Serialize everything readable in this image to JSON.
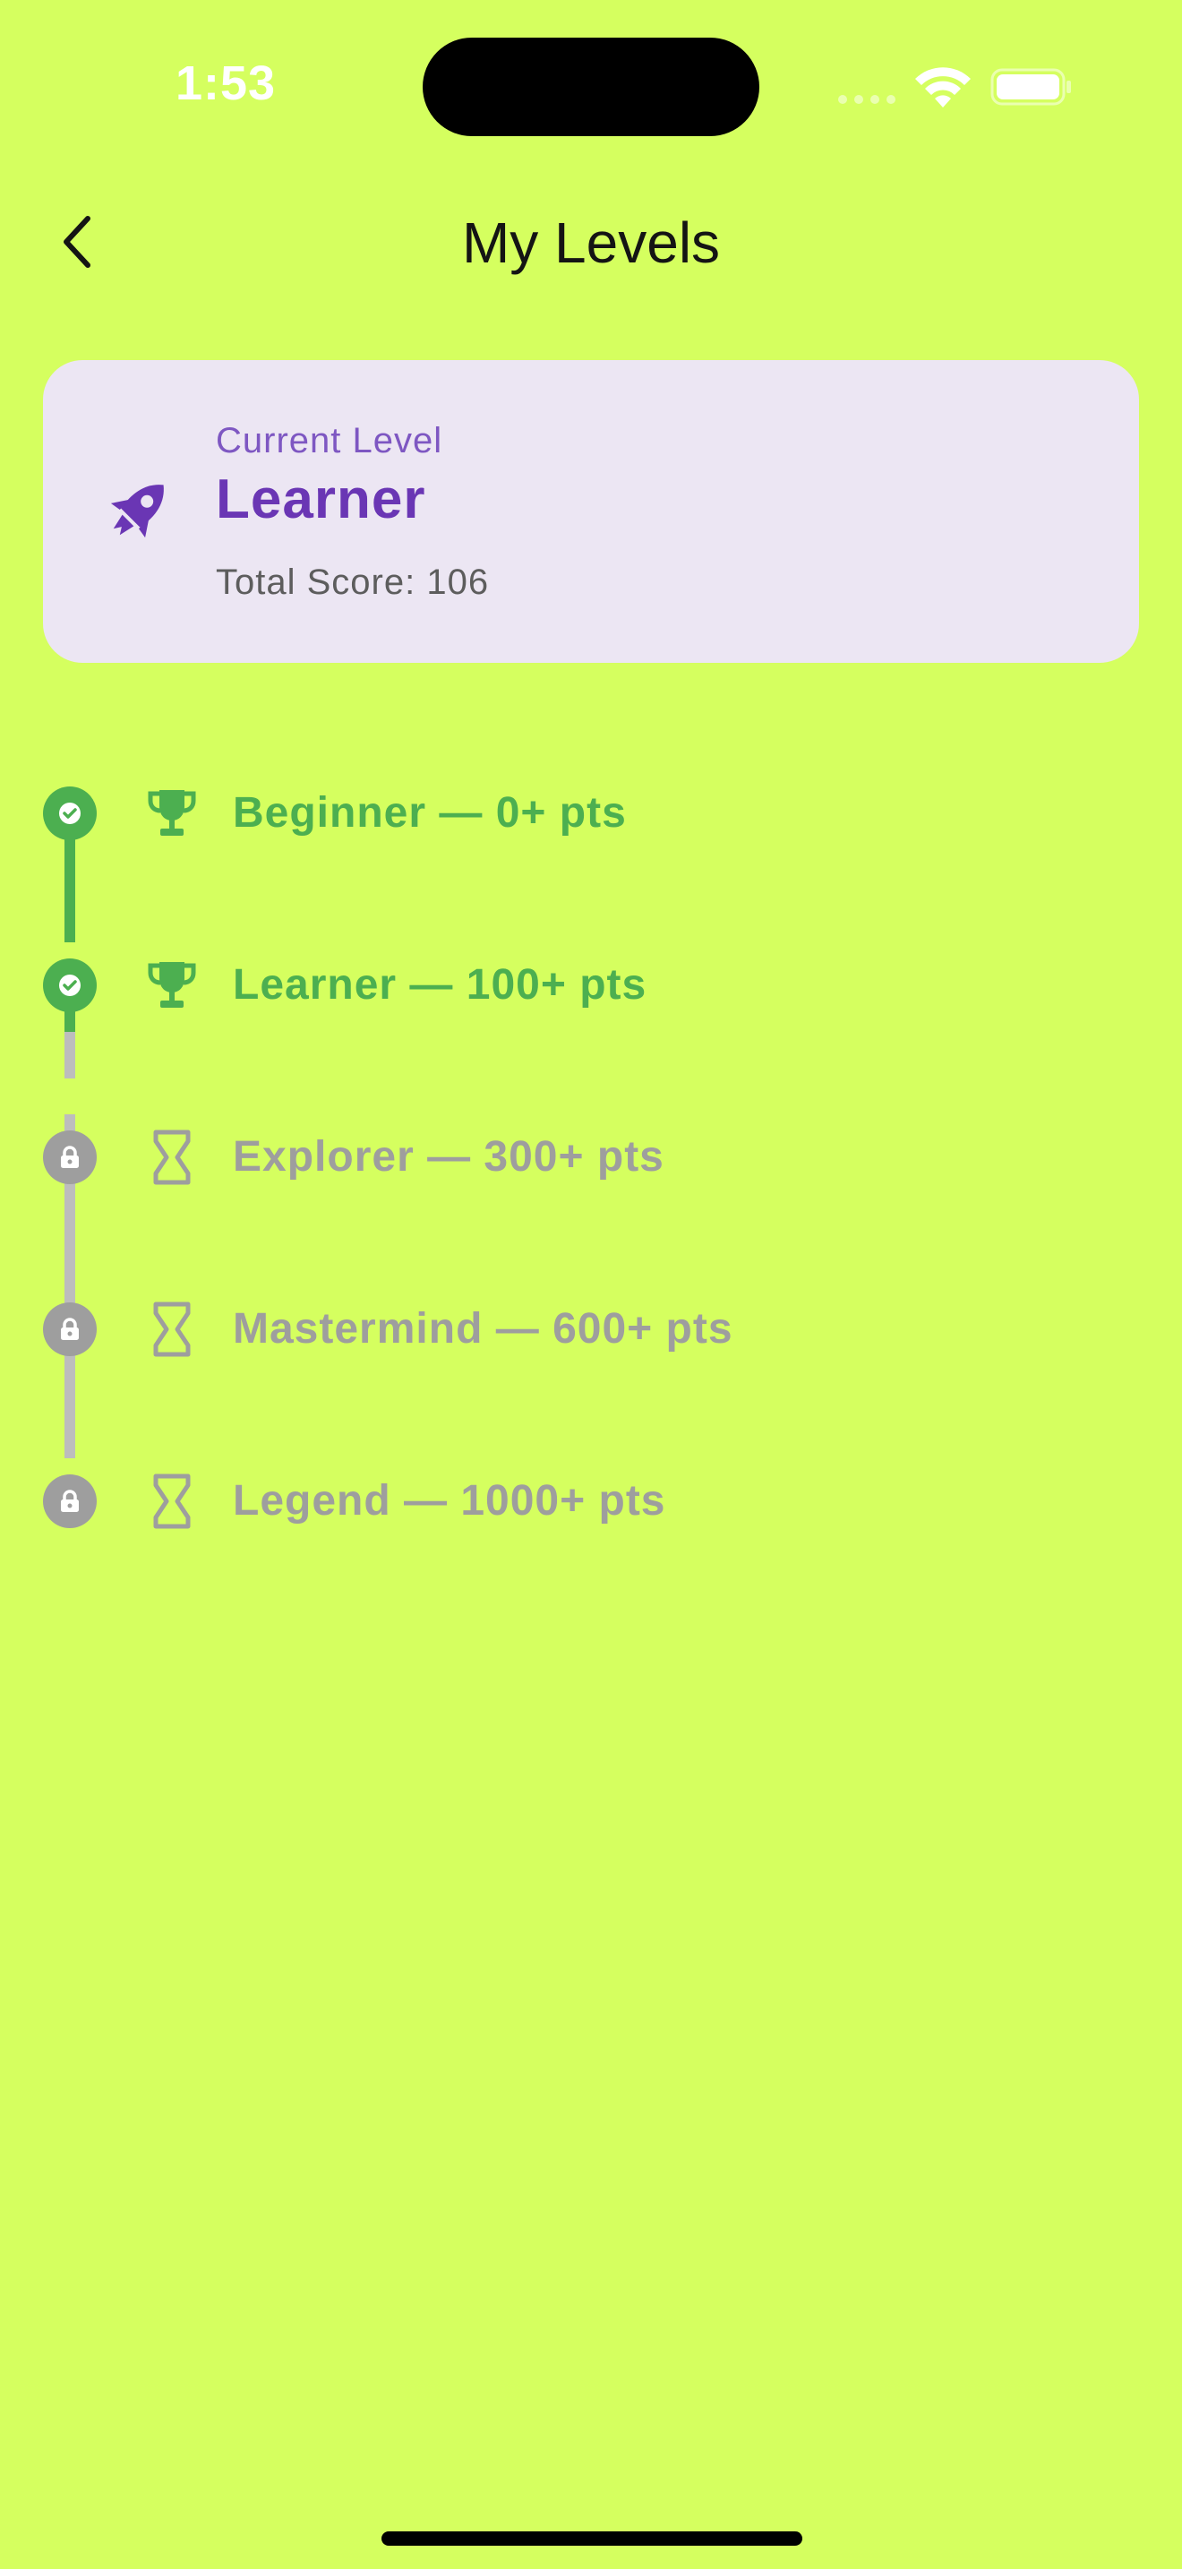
{
  "status_bar": {
    "time": "1:53"
  },
  "header": {
    "title": "My Levels",
    "back_icon": "chevron-left-icon"
  },
  "current_level_card": {
    "icon": "rocket-icon",
    "caption": "Current Level",
    "level_name": "Learner",
    "score_text": "Total Score: 106",
    "accent_color": "#6a36b4",
    "background_color": "#ece6f3"
  },
  "levels": [
    {
      "label": "Beginner — 0+ pts",
      "status": "achieved",
      "status_icon": "check-icon",
      "level_icon": "trophy-icon"
    },
    {
      "label": "Learner — 100+ pts",
      "status": "achieved",
      "status_icon": "check-icon",
      "level_icon": "trophy-icon"
    },
    {
      "label": "Explorer — 300+ pts",
      "status": "locked",
      "status_icon": "lock-icon",
      "level_icon": "hourglass-icon"
    },
    {
      "label": "Mastermind — 600+ pts",
      "status": "locked",
      "status_icon": "lock-icon",
      "level_icon": "hourglass-icon"
    },
    {
      "label": "Legend — 1000+ pts",
      "status": "locked",
      "status_icon": "lock-icon",
      "level_icon": "hourglass-icon"
    }
  ],
  "colors": {
    "background": "#d5ff5f",
    "achieved": "#4caf50",
    "locked": "#9e9e9e",
    "locked_line": "#bdbdbd"
  }
}
